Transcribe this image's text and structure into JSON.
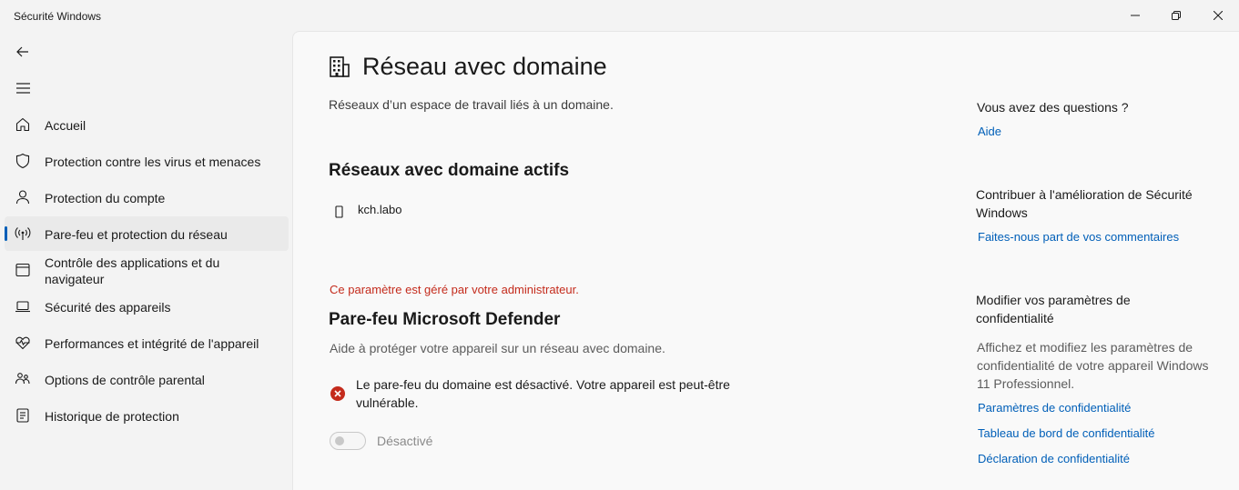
{
  "window": {
    "title": "Sécurité Windows",
    "controls": [
      "minimize",
      "maximize",
      "close"
    ]
  },
  "sidebar": {
    "back_icon": "back-arrow-icon",
    "menu_icon": "hamburger-menu-icon",
    "items": [
      {
        "label": "Accueil",
        "icon": "home-icon",
        "active": false
      },
      {
        "label": "Protection contre les virus et menaces",
        "icon": "shield-icon",
        "active": false
      },
      {
        "label": "Protection du compte",
        "icon": "person-icon",
        "active": false
      },
      {
        "label": "Pare-feu et protection du réseau",
        "icon": "wireless-antenna-icon",
        "active": true
      },
      {
        "label": "Contrôle des applications et du navigateur",
        "icon": "app-window-icon",
        "active": false
      },
      {
        "label": "Sécurité des appareils",
        "icon": "laptop-icon",
        "active": false
      },
      {
        "label": "Performances et intégrité de l'appareil",
        "icon": "heart-pulse-icon",
        "active": false
      },
      {
        "label": "Options de contrôle parental",
        "icon": "family-icon",
        "active": false
      },
      {
        "label": "Historique de protection",
        "icon": "history-icon",
        "active": false
      }
    ]
  },
  "main": {
    "page_icon": "building-icon",
    "title": "Réseau avec domaine",
    "description": "Réseaux d’un espace de travail liés à un domaine.",
    "active_networks": {
      "heading": "Réseaux avec domaine actifs",
      "networks": [
        {
          "name": "kch.labo",
          "icon": "network-device-icon"
        }
      ]
    },
    "admin_note": "Ce paramètre est géré par votre administrateur.",
    "firewall": {
      "heading": "Pare-feu Microsoft Defender",
      "description": "Aide à protéger votre appareil sur un réseau avec domaine.",
      "warning": "Le pare-feu du domaine est désactivé. Votre appareil est peut-être vulnérable.",
      "toggle_state": false,
      "toggle_label": "Désactivé"
    }
  },
  "rail": {
    "questions": {
      "heading": "Vous avez des questions ?",
      "link": "Aide"
    },
    "feedback": {
      "heading": "Contribuer à l'amélioration de Sécurité Windows",
      "link": "Faites-nous part de vos commentaires"
    },
    "privacy": {
      "heading": "Modifier vos paramètres de confidentialité",
      "text": "Affichez et modifiez les paramètres de confidentialité de votre appareil Windows 11 Professionnel.",
      "links": [
        "Paramètres de confidentialité",
        "Tableau de bord de confidentialité",
        "Déclaration de confidentialité"
      ]
    }
  },
  "colors": {
    "accent": "#005fb8",
    "error": "#c42b1c",
    "warning_icon": "#c42b1c"
  }
}
